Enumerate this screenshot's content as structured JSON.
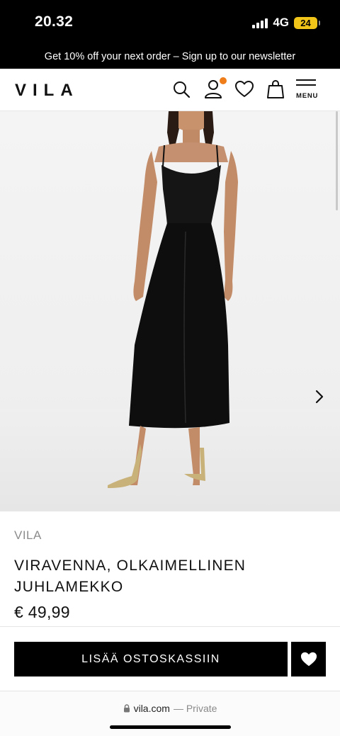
{
  "status_bar": {
    "time": "20.32",
    "network": "4G",
    "battery": "24"
  },
  "promo": {
    "text": "Get 10% off your next order – Sign up to our newsletter"
  },
  "header": {
    "logo": "VILA",
    "icons": [
      "search-icon",
      "account-icon",
      "heart-icon",
      "shopping-bag-icon",
      "menu-icon"
    ],
    "menu_label": "MENU",
    "notification_color": "#ef7d19"
  },
  "gallery": {
    "image_subject": "black slip dress",
    "arrow_icon": "chevron-right-icon"
  },
  "product": {
    "brand": "VILA",
    "title": "VIRAVENNA, OLKAIMELLINEN JUHLAMEKKO",
    "price": "€ 49,99"
  },
  "actions": {
    "add_to_cart": "LISÄÄ OSTOSKASSIIN"
  },
  "browser": {
    "domain": "vila.com",
    "mode": "— Private"
  }
}
